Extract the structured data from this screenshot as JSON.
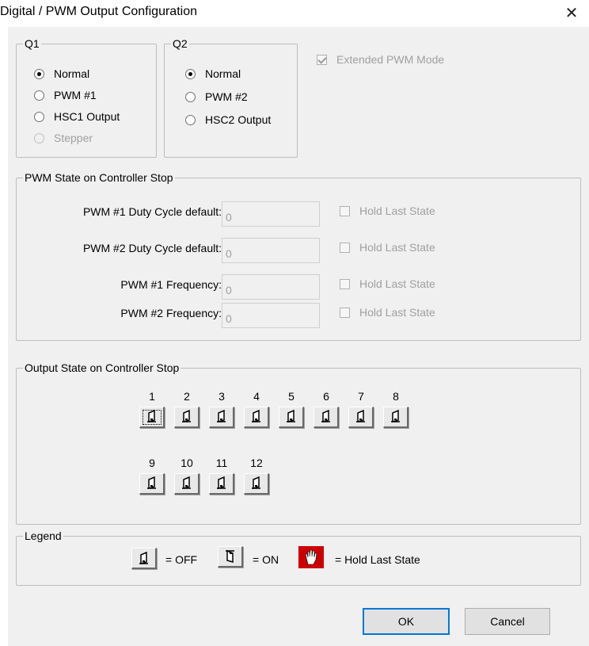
{
  "window": {
    "title": "Digital / PWM Output Configuration",
    "close_glyph": "✕"
  },
  "q1": {
    "title": "Q1",
    "options": [
      {
        "label": "Normal",
        "checked": true,
        "enabled": true
      },
      {
        "label": "PWM #1",
        "checked": false,
        "enabled": true
      },
      {
        "label": "HSC1 Output",
        "checked": false,
        "enabled": true
      },
      {
        "label": "Stepper",
        "checked": false,
        "enabled": false
      }
    ]
  },
  "q2": {
    "title": "Q2",
    "options": [
      {
        "label": "Normal",
        "checked": true,
        "enabled": true
      },
      {
        "label": "PWM #2",
        "checked": false,
        "enabled": true
      },
      {
        "label": "HSC2 Output",
        "checked": false,
        "enabled": true
      }
    ]
  },
  "extended_pwm": {
    "label": "Extended PWM Mode",
    "checked": true,
    "enabled": false
  },
  "pwm_state": {
    "title": "PWM State on Controller Stop",
    "rows": [
      {
        "label": "PWM #1 Duty Cycle default:",
        "value": "0",
        "hold_label": "Hold Last State"
      },
      {
        "label": "PWM #2 Duty Cycle default:",
        "value": "0",
        "hold_label": "Hold Last State"
      },
      {
        "label": "PWM #1 Frequency:",
        "value": "0",
        "hold_label": "Hold Last State"
      },
      {
        "label": "PWM #2 Frequency:",
        "value": "0",
        "hold_label": "Hold Last State"
      }
    ]
  },
  "output_state": {
    "title": "Output State on Controller Stop",
    "outputs": [
      {
        "num": "1",
        "state": "off"
      },
      {
        "num": "2",
        "state": "off"
      },
      {
        "num": "3",
        "state": "off"
      },
      {
        "num": "4",
        "state": "off"
      },
      {
        "num": "5",
        "state": "off"
      },
      {
        "num": "6",
        "state": "off"
      },
      {
        "num": "7",
        "state": "off"
      },
      {
        "num": "8",
        "state": "off"
      },
      {
        "num": "9",
        "state": "off"
      },
      {
        "num": "10",
        "state": "off"
      },
      {
        "num": "11",
        "state": "off"
      },
      {
        "num": "12",
        "state": "off"
      }
    ]
  },
  "legend": {
    "title": "Legend",
    "off_text": "= OFF",
    "on_text": "= ON",
    "hold_text": "= Hold Last State",
    "off_icon": "switch-off-icon",
    "on_icon": "switch-on-icon",
    "hold_icon": "red-hand-icon"
  },
  "buttons": {
    "ok": "OK",
    "cancel": "Cancel"
  },
  "colors": {
    "dialog_bg": "#f0f0f0",
    "hold_red": "#cc0000",
    "disabled_text": "#a0a0a0"
  }
}
